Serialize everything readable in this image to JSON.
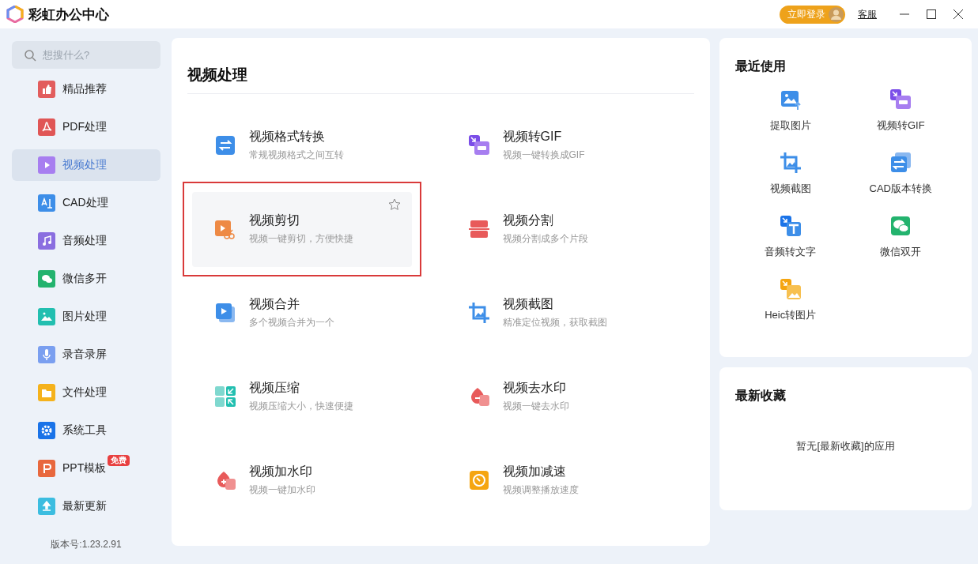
{
  "window": {
    "title": "彩虹办公中心",
    "login_button": "立即登录",
    "support_link": "客服"
  },
  "sidebar": {
    "search": {
      "placeholder": "想搜什么?"
    },
    "items": [
      {
        "label": "精品推荐",
        "selected": false,
        "color": "#e25d5d"
      },
      {
        "label": "PDF处理",
        "selected": false,
        "color": "#e05656"
      },
      {
        "label": "视频处理",
        "selected": true,
        "color": "#a77ef0"
      },
      {
        "label": "CAD处理",
        "selected": false,
        "color": "#3d8ee8"
      },
      {
        "label": "音频处理",
        "selected": false,
        "color": "#8a6ee0"
      },
      {
        "label": "微信多开",
        "selected": false,
        "color": "#23b36e"
      },
      {
        "label": "图片处理",
        "selected": false,
        "color": "#22bfb0"
      },
      {
        "label": "录音录屏",
        "selected": false,
        "color": "#7a9ff0"
      },
      {
        "label": "文件处理",
        "selected": false,
        "color": "#f5b21c"
      },
      {
        "label": "系统工具",
        "selected": false,
        "color": "#1a73e8"
      },
      {
        "label": "PPT模板",
        "selected": false,
        "color": "#e8683e",
        "badge": "免费"
      },
      {
        "label": "最新更新",
        "selected": false,
        "color": "#3cbde0"
      }
    ],
    "version": "版本号:1.23.2.91"
  },
  "main": {
    "title": "视频处理",
    "tools": [
      {
        "name": "视频格式转换",
        "description": "常规视频格式之间互转",
        "highlighted": false
      },
      {
        "name": "视频转GIF",
        "description": "视频一键转换成GIF",
        "highlighted": false
      },
      {
        "name": "视频剪切",
        "description": "视频一键剪切，方便快捷",
        "highlighted": true
      },
      {
        "name": "视频分割",
        "description": "视频分割成多个片段",
        "highlighted": false
      },
      {
        "name": "视频合并",
        "description": "多个视频合并为一个",
        "highlighted": false
      },
      {
        "name": "视频截图",
        "description": "精准定位视频，获取截图",
        "highlighted": false
      },
      {
        "name": "视频压缩",
        "description": "视频压缩大小，快速便捷",
        "highlighted": false
      },
      {
        "name": "视频去水印",
        "description": "视频一键去水印",
        "highlighted": false
      },
      {
        "name": "视频加水印",
        "description": "视频一键加水印",
        "highlighted": false
      },
      {
        "name": "视频加减速",
        "description": "视频调整播放速度",
        "highlighted": false
      }
    ]
  },
  "recent": {
    "title": "最近使用",
    "items": [
      "提取图片",
      "视频转GIF",
      "视频截图",
      "CAD版本转换",
      "音频转文字",
      "微信双开",
      "Heic转图片"
    ]
  },
  "favorites": {
    "title": "最新收藏",
    "empty_text": "暂无[最新收藏]的应用"
  }
}
